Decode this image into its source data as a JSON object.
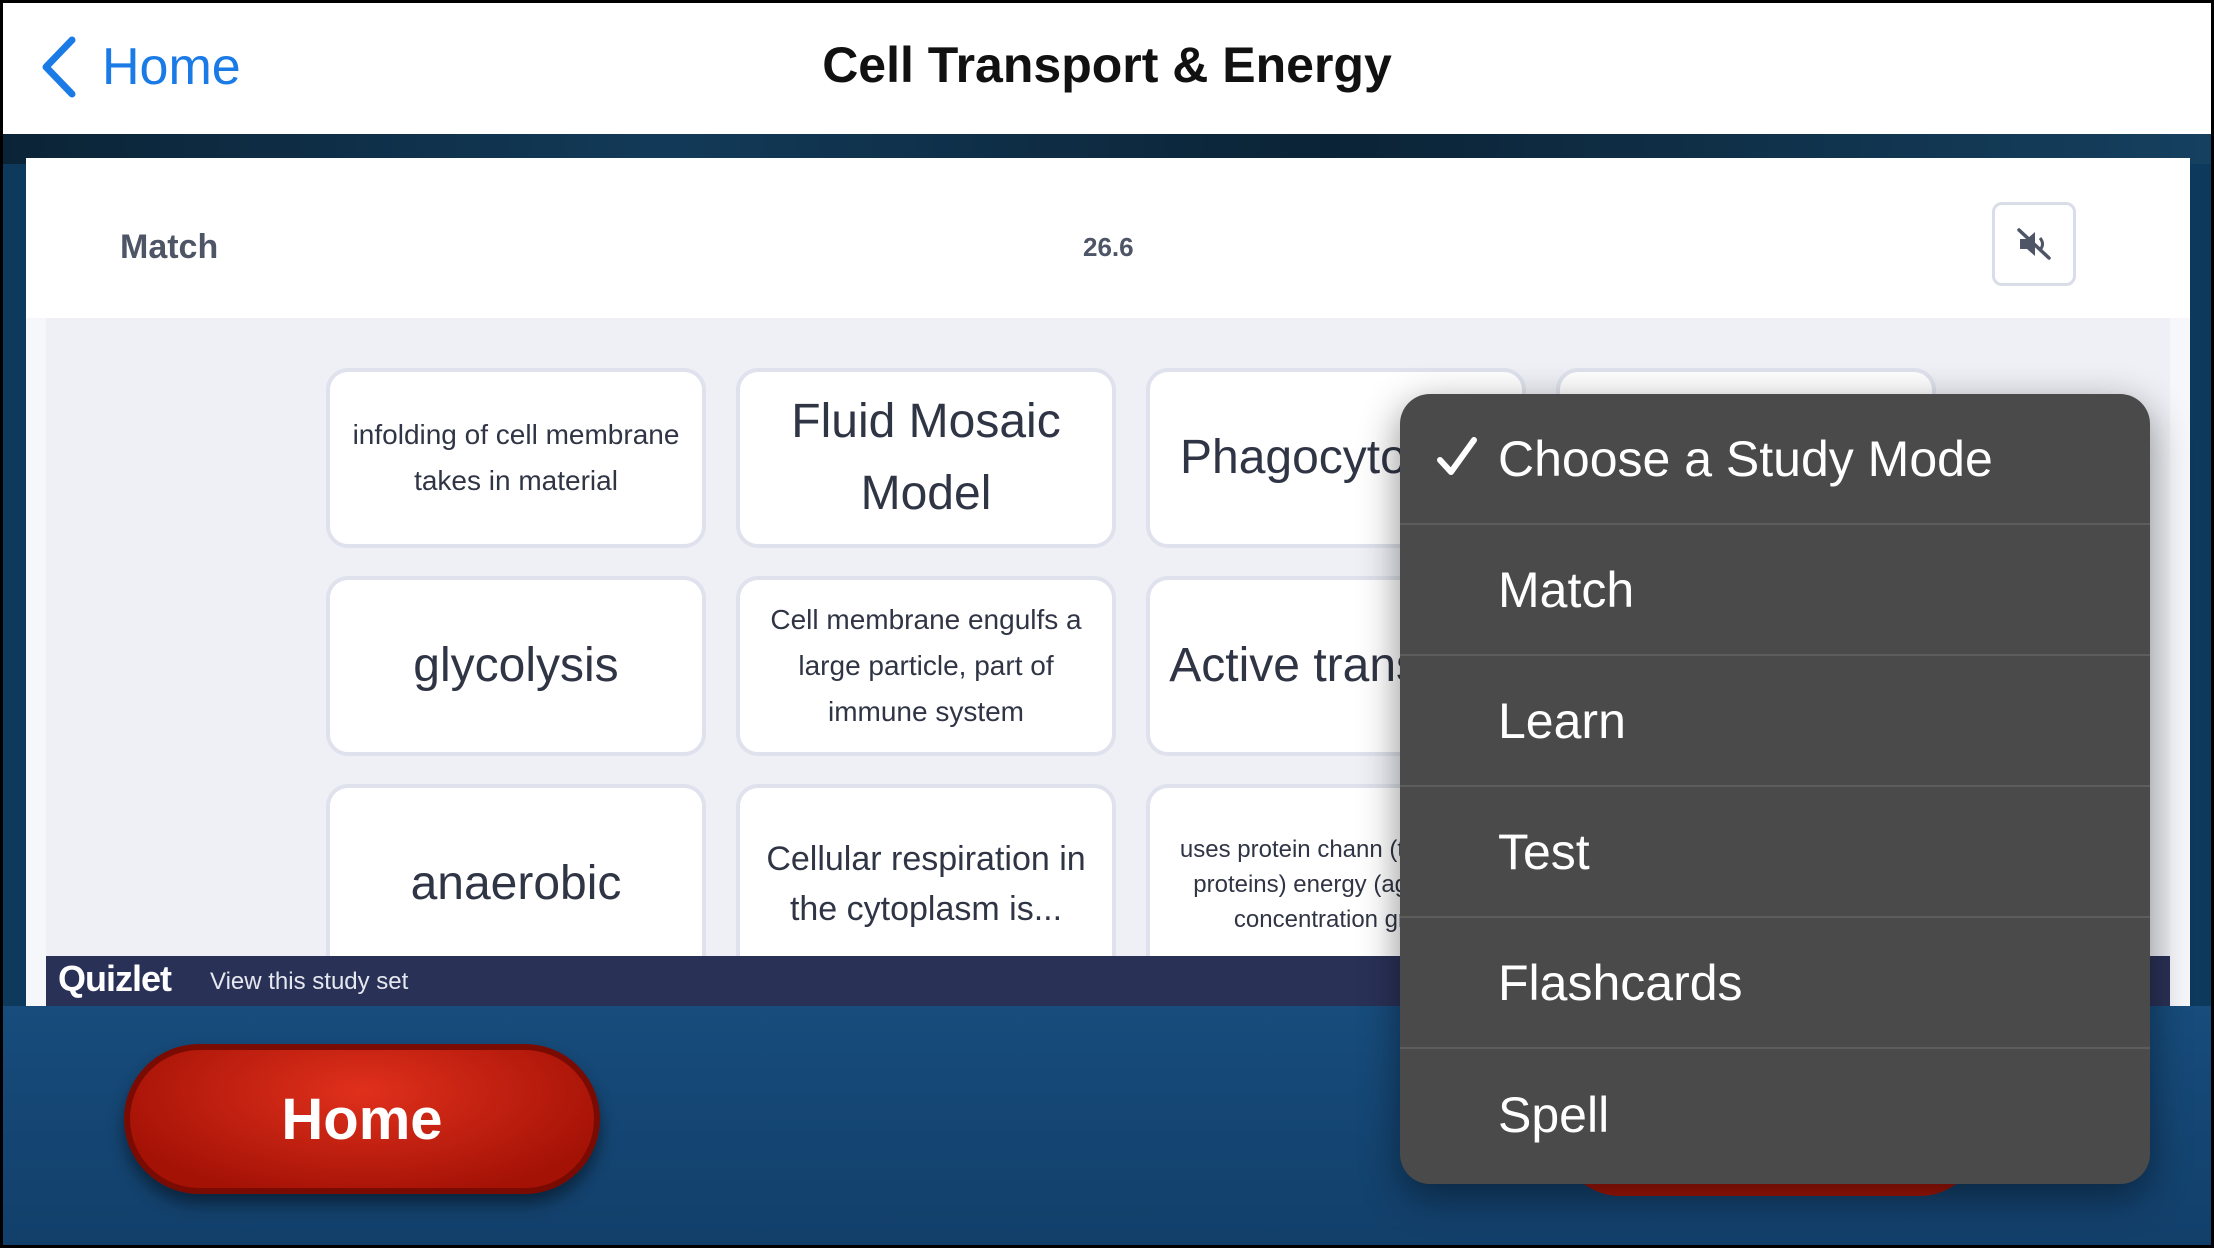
{
  "nav": {
    "back_label": "Home",
    "title": "Cell Transport & Energy"
  },
  "embed": {
    "mode_label": "Match",
    "timer": "26.6",
    "footer_logo": "Quizlet",
    "footer_link": "View this study set"
  },
  "cards": [
    {
      "text": "infolding of cell membrane takes in material"
    },
    {
      "text": "Fluid Mosaic Model"
    },
    {
      "text": "Phagocyto"
    },
    {
      "text": ""
    },
    {
      "text": "glycolysis"
    },
    {
      "text": "Cell membrane engulfs a large particle, part of immune system"
    },
    {
      "text": "Active transport"
    },
    {
      "text": "anaerobic"
    },
    {
      "text": "Cellular respiration in the cytoplasm is..."
    },
    {
      "text": "uses protein chann (transport proteins) energy (against a concentration gradi"
    }
  ],
  "bottom": {
    "home_button": "Home"
  },
  "menu": {
    "items": [
      {
        "label": "Choose a Study Mode",
        "checked": true
      },
      {
        "label": "Match",
        "checked": false
      },
      {
        "label": "Learn",
        "checked": false
      },
      {
        "label": "Test",
        "checked": false
      },
      {
        "label": "Flashcards",
        "checked": false
      },
      {
        "label": "Spell",
        "checked": false
      }
    ]
  },
  "icons": {
    "back": "chevron-left-icon",
    "mute": "speaker-muted-icon",
    "check": "checkmark-icon"
  },
  "colors": {
    "accent_blue": "#1a7ae6",
    "home_red": "#c81e0e",
    "menu_bg": "#4a4a4b",
    "quizlet_footer": "#2a3157"
  }
}
